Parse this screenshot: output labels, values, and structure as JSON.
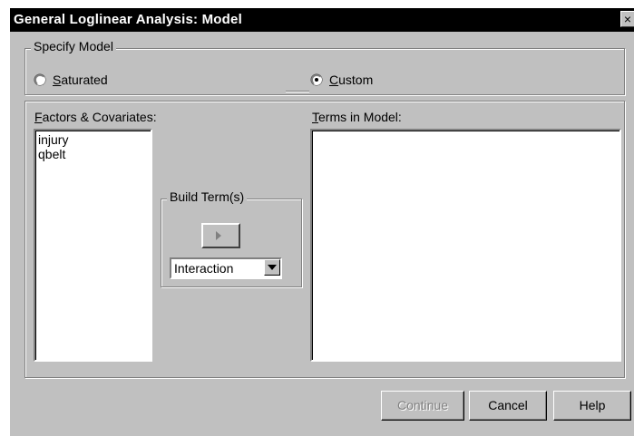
{
  "window": {
    "title": "General Loglinear Analysis: Model",
    "close_label": "×"
  },
  "specify_model": {
    "legend": "Specify Model",
    "saturated_label": "Saturated",
    "custom_label": "Custom",
    "selected": "Custom"
  },
  "factors": {
    "label": "Factors & Covariates:",
    "items": [
      "injury",
      "qbelt"
    ]
  },
  "build_term": {
    "legend": "Build Term(s)",
    "arrow_icon": "right-arrow-icon",
    "combo_value": "Interaction"
  },
  "terms": {
    "label": "Terms in Model:",
    "items": []
  },
  "buttons": {
    "continue_label": "Continue",
    "cancel_label": "Cancel",
    "help_label": "Help"
  }
}
